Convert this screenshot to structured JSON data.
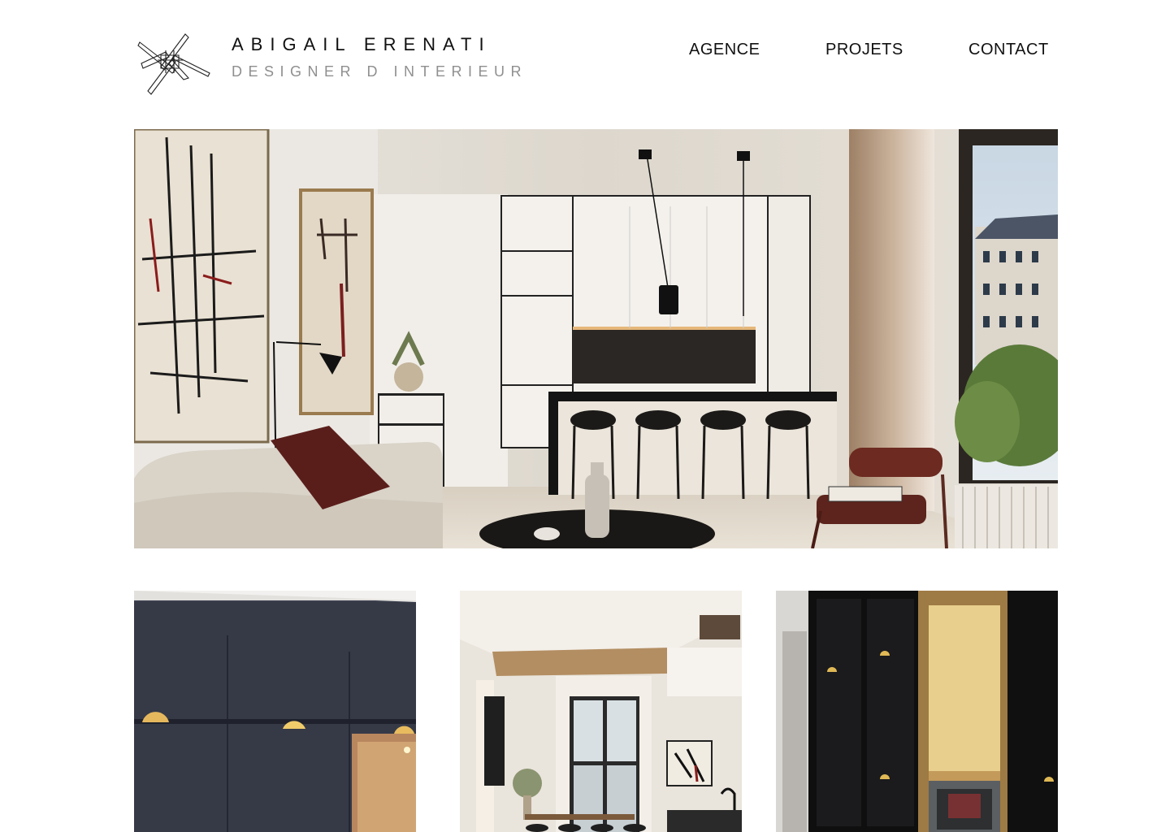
{
  "brand": {
    "name": "ABIGAIL ERENATI",
    "tagline": "DESIGNER D INTERIEUR",
    "logo_icon": "abstract-lines-logo"
  },
  "nav": {
    "items": [
      {
        "label": "AGENCE"
      },
      {
        "label": "PROJETS"
      },
      {
        "label": "CONTACT"
      }
    ]
  },
  "colors": {
    "background": "#ffffff",
    "text": "#111111",
    "tagline": "#8f8f8f"
  }
}
